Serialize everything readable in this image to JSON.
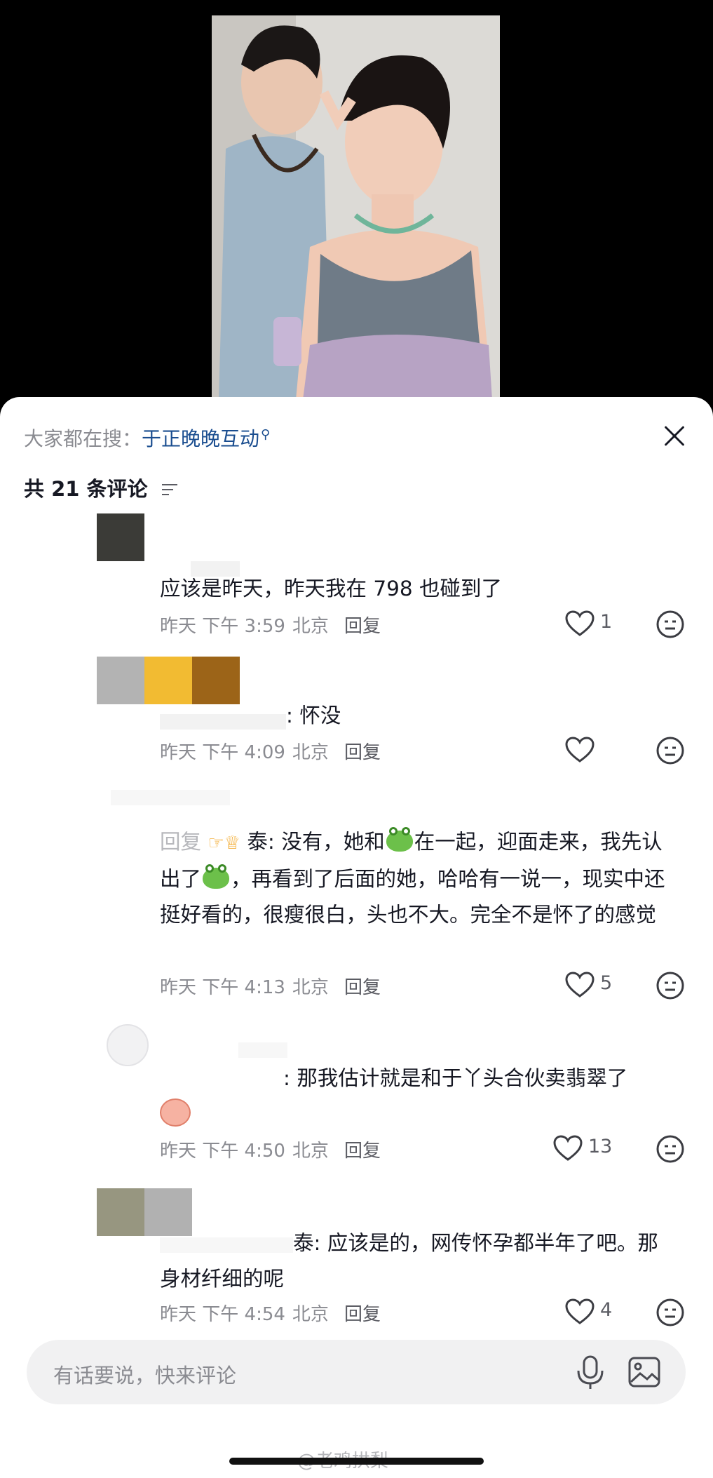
{
  "search": {
    "label": "大家都在搜：",
    "keyword": "于正晚晚互动"
  },
  "comments_header": {
    "count_text": "共 21 条评论"
  },
  "comments": [
    {
      "prefix": "",
      "text": "应该是昨天，昨天我在 798 也碰到了",
      "time": "昨天 下午 3:59",
      "location": "北京",
      "reply": "回复",
      "likes": "1"
    },
    {
      "prefix": "",
      "text": ": 怀没",
      "time": "昨天 下午 4:09",
      "location": "北京",
      "reply": "回复",
      "likes": ""
    },
    {
      "prefix": "回复",
      "text_a": "泰: 没有，她和",
      "text_b": "在一起，迎面走来，我先认出了",
      "text_c": "，再看到了后面的她，哈哈有一说一，现实中还挺好看的，很瘦很白，头也不大。完全不是怀了的感觉",
      "time": "昨天 下午 4:13",
      "location": "北京",
      "reply": "回复",
      "likes": "5"
    },
    {
      "prefix": "",
      "text": ": 那我估计就是和于丫头合伙卖翡翠了",
      "time": "昨天 下午 4:50",
      "location": "北京",
      "reply": "回复",
      "likes": "13"
    },
    {
      "prefix": "",
      "text": "泰: 应该是的，网传怀孕都半年了吧。那身材纤细的呢",
      "time": "昨天 下午 4:54",
      "location": "北京",
      "reply": "回复",
      "likes": "4"
    }
  ],
  "input": {
    "placeholder": "有话要说，快来评论"
  },
  "watermark": "@老鸡拱梨",
  "colors": {
    "keyword": "#1a4d8f",
    "muted": "#8a8b91",
    "sheet": "#ffffff",
    "input_bg": "#f1f1f2"
  }
}
